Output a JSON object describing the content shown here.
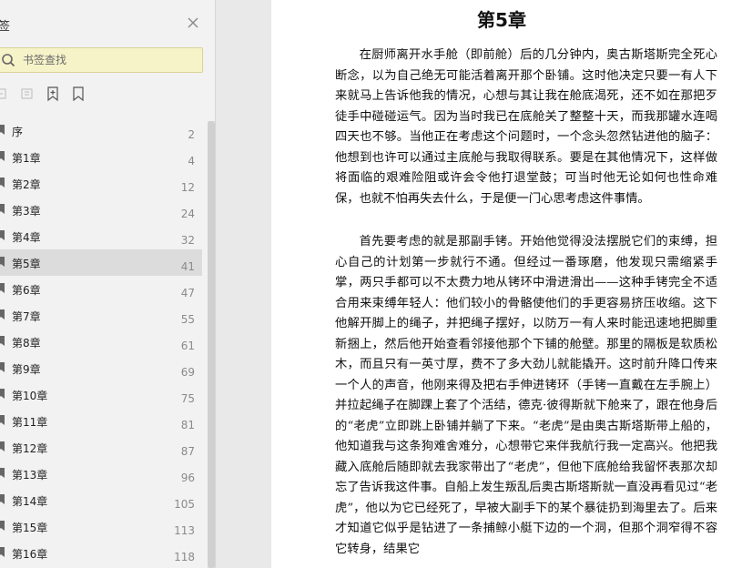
{
  "sidebar": {
    "title": "签",
    "search_placeholder": "书签查找",
    "items": [
      {
        "label": "序",
        "page": "2"
      },
      {
        "label": "第1章",
        "page": "4"
      },
      {
        "label": "第2章",
        "page": "12"
      },
      {
        "label": "第3章",
        "page": "24"
      },
      {
        "label": "第4章",
        "page": "32"
      },
      {
        "label": "第5章",
        "page": "41",
        "active": true
      },
      {
        "label": "第6章",
        "page": "47"
      },
      {
        "label": "第7章",
        "page": "55"
      },
      {
        "label": "第8章",
        "page": "61"
      },
      {
        "label": "第9章",
        "page": "69"
      },
      {
        "label": "第10章",
        "page": "75"
      },
      {
        "label": "第11章",
        "page": "81"
      },
      {
        "label": "第12章",
        "page": "87"
      },
      {
        "label": "第13章",
        "page": "96"
      },
      {
        "label": "第14章",
        "page": "105"
      },
      {
        "label": "第15章",
        "page": "113"
      },
      {
        "label": "第16章",
        "page": "118"
      }
    ]
  },
  "document": {
    "chapter_title": "第5章",
    "paragraphs": [
      "在厨师离开水手舱（即前舱）后的几分钟内，奥古斯塔斯完全死心断念，以为自己绝无可能活着离开那个卧铺。这时他决定只要一有人下来就马上告诉他我的情况，心想与其让我在舱底渴死，还不如在那把歹徒手中碰碰运气。因为当时我已在底舱关了整整十天，而我那罐水连喝四天也不够。当他正在考虑这个问题时，一个念头忽然钻进他的脑子：他想到也许可以通过主底舱与我取得联系。要是在其他情况下，这样做将面临的艰难险阻或许会令他打退堂鼓；可当时他无论如何也性命难保，也就不怕再失去什么，于是便一门心思考虑这件事情。",
      "首先要考虑的就是那副手铐。开始他觉得没法摆脱它们的束缚，担心自己的计划第一步就行不通。但经过一番琢磨，他发现只需缩紧手掌，两只手都可以不太费力地从铐环中滑进滑出——这种手铐完全不适合用来束缚年轻人：他们较小的骨骼使他们的手更容易挤压收缩。这下他解开脚上的绳子，并把绳子摆好，以防万一有人来时能迅速地把脚重新捆上，然后他开始查看邻接他那个下铺的舱壁。那里的隔板是软质松木，而且只有一英寸厚，费不了多大劲儿就能撬开。这时前升降口传来一个人的声音，他刚来得及把右手伸进铐环（手铐一直戴在左手腕上）并拉起绳子在脚踝上套了个活结，德克·彼得斯就下舱来了，跟在他身后的“老虎”立即跳上卧铺并躺了下来。“老虎”是由奥古斯塔斯带上船的，他知道我与这条狗难舍难分，心想带它来伴我航行我一定高兴。他把我藏入底舱后随即就去我家带出了“老虎”，但他下底舱给我留怀表那次却忘了告诉我这件事。自船上发生叛乱后奥古斯塔斯就一直没再看见过“老虎”，他以为它已经死了，早被大副手下的某个暴徒扔到海里去了。后来才知道它似乎是钻进了一条捕鲸小艇下边的一个洞，但那个洞窄得不容它转身，结果它"
    ]
  }
}
